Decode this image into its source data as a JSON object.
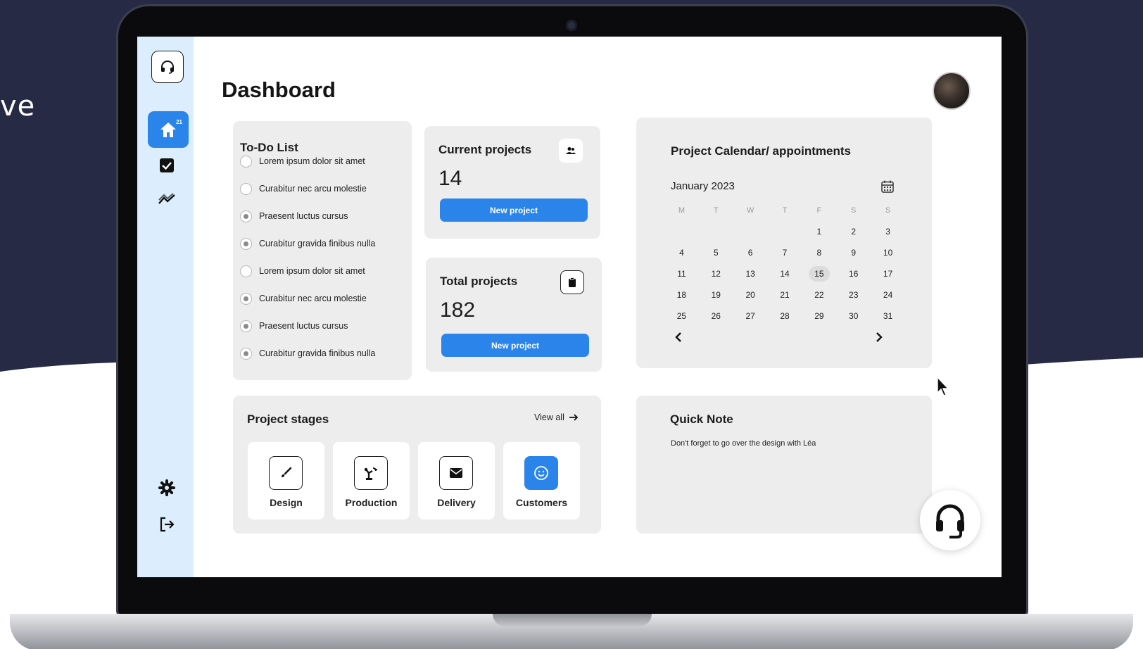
{
  "background": {
    "dark_color": "#262a44",
    "side_text": "ve"
  },
  "app": {
    "title": "Dashboard"
  },
  "sidebar": {
    "logo_icon": "headset-icon",
    "items": [
      {
        "icon": "home-icon",
        "badge": "21",
        "active": true
      },
      {
        "icon": "checkbox-icon"
      },
      {
        "icon": "analytics-icon"
      },
      {
        "icon": "gear-icon"
      },
      {
        "icon": "logout-icon"
      }
    ]
  },
  "todo": {
    "title": "To-Do List",
    "items": [
      {
        "label": "Lorem ipsum dolor sit amet",
        "checked": false
      },
      {
        "label": "Curabitur nec arcu molestie",
        "checked": false
      },
      {
        "label": "Praesent luctus cursus",
        "checked": true
      },
      {
        "label": "Curabitur gravida finibus nulla",
        "checked": true
      },
      {
        "label": "Lorem ipsum dolor sit amet",
        "checked": false
      },
      {
        "label": "Curabitur nec arcu molestie",
        "checked": true
      },
      {
        "label": "Praesent luctus cursus",
        "checked": true
      },
      {
        "label": "Curabitur gravida finibus nulla",
        "checked": true
      }
    ]
  },
  "current_projects": {
    "title": "Current projects",
    "count": "14",
    "button": "New project",
    "icon": "people-icon"
  },
  "total_projects": {
    "title": "Total projects",
    "count": "182",
    "button": "New project",
    "icon": "clipboard-icon"
  },
  "calendar": {
    "title": "Project Calendar/ appointments",
    "month": "January 2023",
    "weekdays": [
      "M",
      "T",
      "W",
      "T",
      "F",
      "S",
      "S"
    ],
    "weeks": [
      [
        "",
        "",
        "",
        "",
        "1",
        "2",
        "3"
      ],
      [
        "4",
        "5",
        "6",
        "7",
        "8",
        "9",
        "10"
      ],
      [
        "11",
        "12",
        "13",
        "14",
        "15",
        "16",
        "17"
      ],
      [
        "18",
        "19",
        "20",
        "21",
        "22",
        "23",
        "24"
      ],
      [
        "25",
        "26",
        "27",
        "28",
        "29",
        "30",
        "31"
      ]
    ],
    "highlighted_day": "15"
  },
  "stages": {
    "title": "Project stages",
    "view_all": "View all",
    "items": [
      {
        "label": "Design",
        "icon": "brush-icon"
      },
      {
        "label": "Production",
        "icon": "robot-arm-icon"
      },
      {
        "label": "Delivery",
        "icon": "envelope-icon"
      },
      {
        "label": "Customers",
        "icon": "smile-icon",
        "active": true
      }
    ]
  },
  "quick_note": {
    "title": "Quick Note",
    "text": "Don't forget to go over the design with Léa"
  },
  "colors": {
    "accent": "#2b84ea",
    "sidebar": "#dceefd",
    "card": "#ededed"
  }
}
